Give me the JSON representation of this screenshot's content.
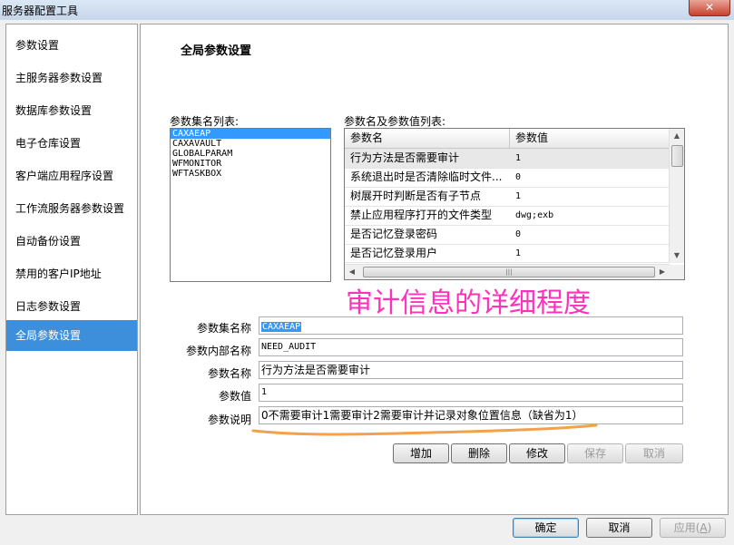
{
  "window": {
    "title": "服务器配置工具",
    "close_glyph": "✕"
  },
  "sidebar": {
    "items": [
      {
        "label": "参数设置"
      },
      {
        "label": "主服务器参数设置"
      },
      {
        "label": "数据库参数设置"
      },
      {
        "label": "电子仓库设置"
      },
      {
        "label": "客户端应用程序设置"
      },
      {
        "label": "工作流服务器参数设置"
      },
      {
        "label": "自动备份设置"
      },
      {
        "label": "禁用的客户IP地址"
      },
      {
        "label": "日志参数设置"
      },
      {
        "label": "全局参数设置"
      }
    ],
    "active_index": 9
  },
  "main": {
    "heading": "全局参数设置",
    "set_list_label": "参数集名列表:",
    "param_list_label": "参数名及参数值列表:",
    "sets": [
      "CAXAEAP",
      "CAXAVAULT",
      "GLOBALPARAM",
      "WFMONITOR",
      "WFTASKBOX"
    ],
    "selected_set_index": 0,
    "grid": {
      "columns": [
        "参数名",
        "参数值"
      ],
      "rows": [
        {
          "name": "行为方法是否需要审计",
          "value": "1"
        },
        {
          "name": "系统退出时是否清除临时文件...",
          "value": "0"
        },
        {
          "name": "树展开时判断是否有子节点",
          "value": "1"
        },
        {
          "name": "禁止应用程序打开的文件类型",
          "value": "dwg;exb"
        },
        {
          "name": "是否记忆登录密码",
          "value": "0"
        },
        {
          "name": "是否记忆登录用户",
          "value": "1"
        }
      ],
      "selected_row_index": 0
    },
    "form": {
      "set_name_label": "参数集名称",
      "set_name_value": "CAXAEAP",
      "internal_name_label": "参数内部名称",
      "internal_name_value": "NEED_AUDIT",
      "param_name_label": "参数名称",
      "param_name_value": "行为方法是否需要审计",
      "param_value_label": "参数值",
      "param_value_value": "1",
      "description_label": "参数说明",
      "description_value": "0不需要审计1需要审计2需要审计并记录对象位置信息（缺省为1）"
    },
    "annotation": {
      "text": "审计信息的详细程度",
      "color": "#ff33bb",
      "underline_color": "#f5a04a"
    },
    "actions": {
      "add": "增加",
      "delete": "删除",
      "modify": "修改",
      "save": "保存",
      "cancel": "取消"
    }
  },
  "footer": {
    "ok": "确定",
    "cancel": "取消",
    "apply_text": "应用",
    "apply_mnemonic": "A"
  }
}
